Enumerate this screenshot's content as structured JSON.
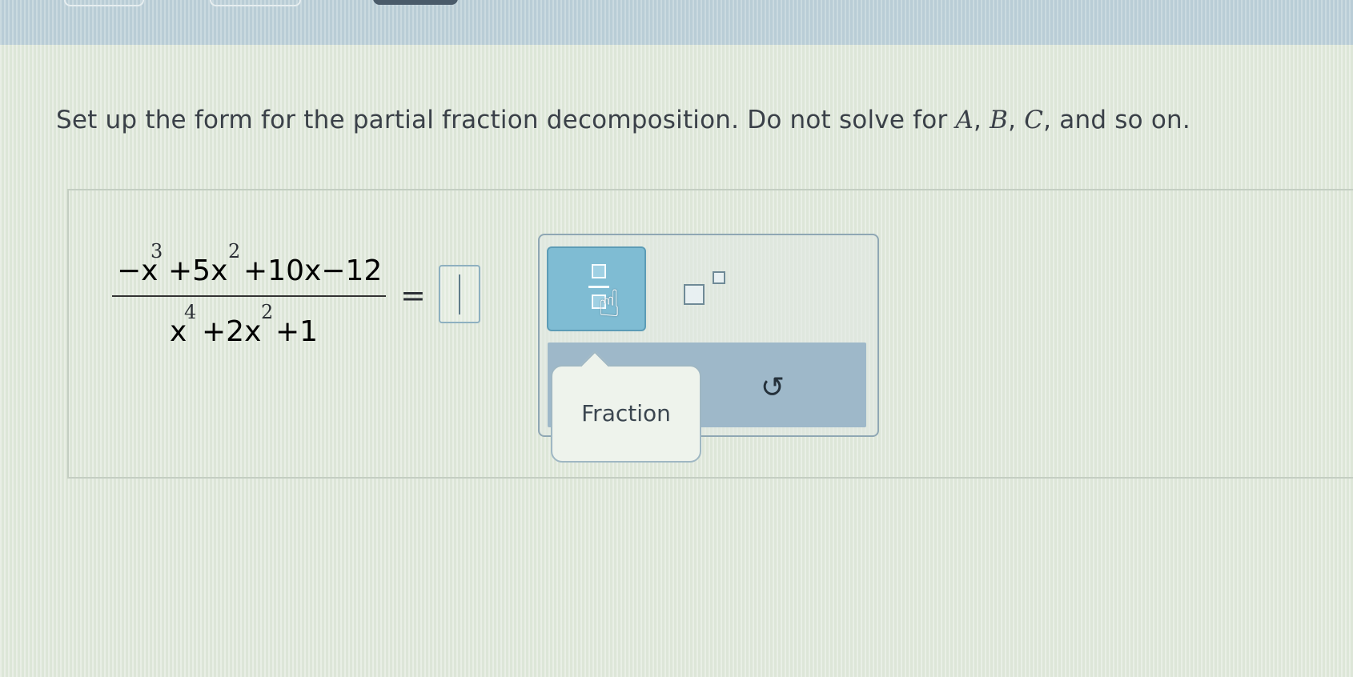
{
  "prompt": {
    "text_start": "Set up the form for the partial fraction decomposition. Do not solve for ",
    "var_a": "A",
    "sep1": ", ",
    "var_b": "B",
    "sep2": ", ",
    "var_c": "C",
    "text_end": ", and so on."
  },
  "expression": {
    "numerator": {
      "t1": "−x",
      "e1": "3",
      "t2": "+5x",
      "e2": "2",
      "t3": "+10x−12"
    },
    "denominator": {
      "t1": "x",
      "e1": "4",
      "t2": "+2x",
      "e2": "2",
      "t3": "+1"
    },
    "equals": "="
  },
  "palette": {
    "tooltip_label": "Fraction",
    "undo_symbol": "↺",
    "icons": [
      "fraction-icon",
      "superscript-icon",
      "undo-icon",
      "hand-cursor-icon"
    ]
  },
  "colors": {
    "fraction_button_bg": "#7fbcd3",
    "palette_bar": "#9eb8c9",
    "answer_box_border": "#8eb0c0"
  }
}
